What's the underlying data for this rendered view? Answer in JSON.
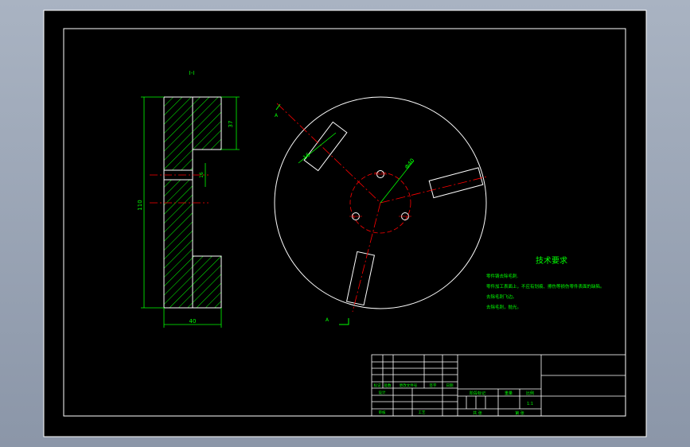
{
  "colors": {
    "background": "#000000",
    "frame": "#ffffff",
    "hatch": "#00ff00",
    "centerline": "#ff0000",
    "dimension": "#00ff00",
    "text": "#00ff00"
  },
  "section_view": {
    "label": "I-I",
    "dim_height": "110",
    "dim_width": "40",
    "dim_top_step": "37",
    "dim_slot": "16"
  },
  "plan_view": {
    "dim_slot": "16",
    "dim_diameter": "Φ40",
    "section_mark_top": "A",
    "section_mark_bottom": "A"
  },
  "tech_requirements": {
    "title": "技术要求",
    "lines": [
      "零件铸去除毛刺.",
      "零件加工表面上，不应有划痕、擦伤等损伤零件表面的缺陷。",
      "去除毛刺飞边。",
      "去除毛刺，抛光。"
    ]
  },
  "title_block": {
    "row_labels": [
      "标记",
      "处数",
      "更改文件号",
      "签字",
      "日期"
    ],
    "design_label": "设计",
    "approve_label": "审核",
    "process_label": "工艺",
    "stage_label": "阶段标记",
    "weight_label": "重量",
    "scale_label": "比例",
    "scale_value": "1:1",
    "sheet_label": "共 张",
    "page_label": "第 张"
  }
}
